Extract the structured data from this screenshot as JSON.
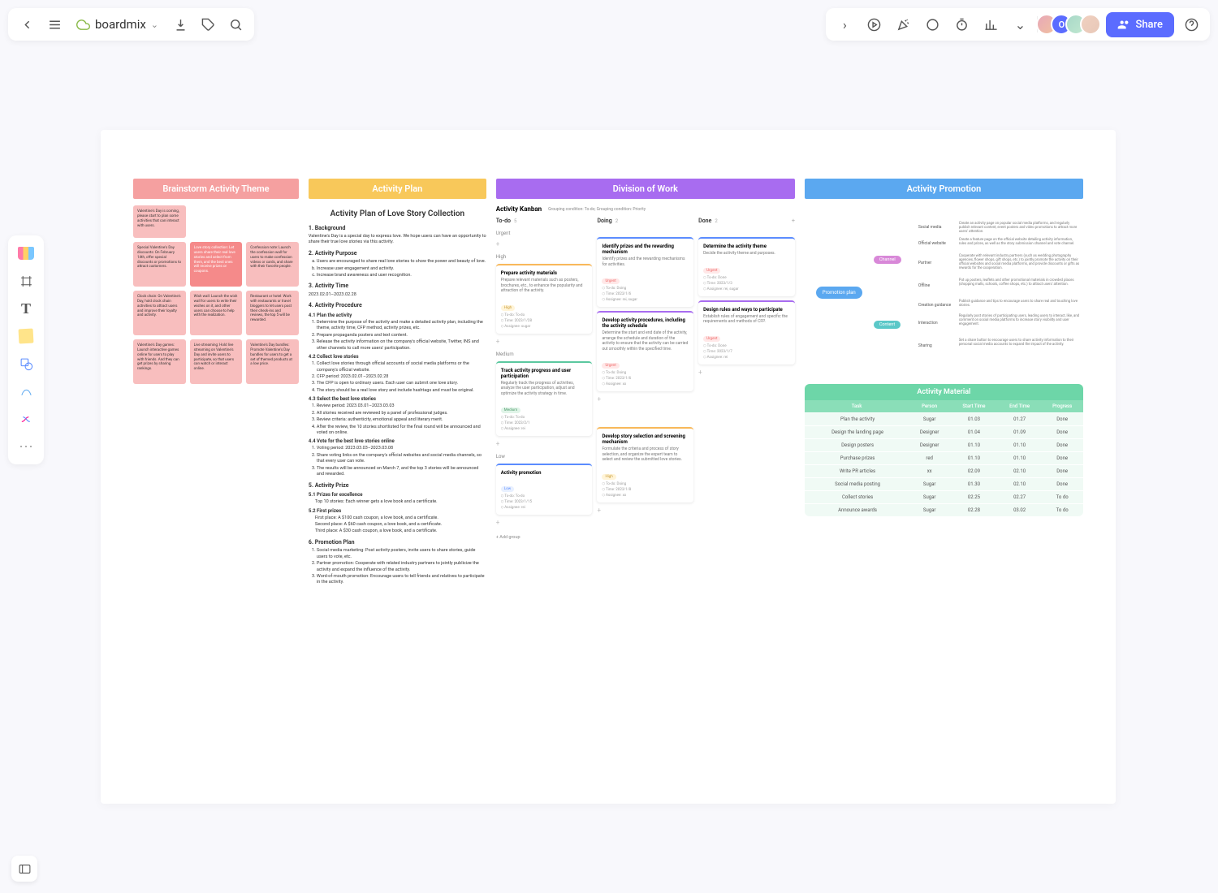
{
  "app": {
    "title": "boardmix"
  },
  "share": "Share",
  "headers": {
    "c1": "Brainstorm Activity Theme",
    "c2": "Activity Plan",
    "c3": "Division of Work",
    "c4": "Activity Promotion"
  },
  "notes": [
    "Valentine's Day is coming, please start to plan some activities that can interact with users.",
    "Special Valentine's Day discounts: On February 14th, offer special discounts or promotions to attract customers.",
    "Love story collection: Let users share their real love stories and select from them, and the best ones will receive prizes or coupons.",
    "Confession note: Launch the confession wall for users to make confession videos or cards, and share with their favorite people.",
    "Clock chain: On Valentine's Day, hold clock chain activities to attract users and improve their loyalty and activity.",
    "Wish wall: Launch the wish wall for users to write their wishes on it, and other users can choose to help with the realization.",
    "Restaurant or hotel: Work with restaurants or travel bloggers to let users post their check-ins and reviews, the top 5 will be rewarded.",
    "Valentine's Day games: Launch interactive games online for users to play with friends. And they can get prizes by sharing rankings.",
    "Live streaming: Hold live streaming on Valentine's Day and invite users to participate, so that users can watch or interact online.",
    "Valentine's Day bundles: Promote Valentine's Day bundles for users to get a set of themed products at a low price."
  ],
  "doc": {
    "title": "Activity Plan of Love Story Collection",
    "s1": "1. Background",
    "s1t": "Valentine's Day is a special day to express love. We hope users can have an opportunity to share their true love stories via this activity.",
    "s2": "2. Activity Purpose",
    "s2a": "Users are encouraged to share real love stories to show the power and beauty of love.",
    "s2b": "Increase user engagement and activity.",
    "s2c": "Increase brand awareness and user recognition.",
    "s3": "3. Activity Time",
    "s3t": "2023.02.01–2023.02.28",
    "s4": "4. Activity Procedure",
    "s41": "4.1 Plan the activity",
    "s41a": "Determine the purpose of the activity and make a detailed activity plan, including the theme, activity time, CFP method, activity prizes, etc.",
    "s41b": "Prepare propaganda posters and text content.",
    "s41c": "Release the activity information on the company's official website, Twitter, INS and other channels to call more users' participation.",
    "s42": "4.2 Collect love stories",
    "s42a": "Collect love stories through official accounts of social media platforms or the company's official website.",
    "s42b": "CFP period: 2023.02.01–2023.02.28",
    "s42c": "The CFP is open to ordinary users. Each user can submit one love story.",
    "s42d": "The story should be a real love story and include hashtags and must be original.",
    "s43": "4.3 Select the best love stories",
    "s43a": "Review period: 2023.03.01–2023.03.03",
    "s43b": "All stories received are reviewed by a panel of professional judges.",
    "s43c": "Review criteria: authenticity, emotional appeal and literary merit.",
    "s43d": "After the review, the 10 stories shortlisted for the final round will be announced and voted on online.",
    "s44": "4.4 Vote for the best love stories online",
    "s44a": "Voting period: 2023.03.03–2023.03.08",
    "s44b": "Share voting links on the company's official websites and social media channels, so that every user can vote.",
    "s44c": "The results will be announced on March 7, and the top 3 stories will be announced and rewarded.",
    "s5": "5. Activity Prize",
    "s51": "5.1 Prizes for excellence",
    "s51t": "Top 10 stories: Each winner gets a love book and a certificate.",
    "s52": "5.2 First prizes",
    "s52a": "First place: A $100 cash coupon, a love book, and a certificate.",
    "s52b": "Second place: A $60 cash coupon, a love book, and a certificate.",
    "s52c": "Third place: A $30 cash coupon, a love book, and a certificate.",
    "s6": "6. Promotion Plan",
    "s6a": "Social media marketing: Post activity posters, invite users to share stories, guide users to vote, etc.",
    "s6b": "Partner promotion: Cooperate with related industry partners to jointly publicize the activity and expand the influence of the activity.",
    "s6c": "Word-of-mouth promotion: Encourage users to tell friends and relatives to participate in the activity."
  },
  "kanban": {
    "title": "Activity Kanban",
    "sub": "Grouping condition: To-do; Grouping condition: Priority",
    "cols": {
      "todo": "To-do",
      "doing": "Doing",
      "done": "Done"
    },
    "cnt": {
      "todo": "5",
      "doing": "2",
      "done": "2"
    },
    "pri": {
      "u": "Urgent",
      "h": "High",
      "m": "Medium",
      "l": "Low"
    },
    "cards": {
      "d1": {
        "t": "Identify prizes and the rewarding mechanism",
        "d": "Identify prizes and the rewarding mechanisms for activities.",
        "tag": "Urgent",
        "m1": "To-do: Doing",
        "m2": "Time: 2023/1/6",
        "m3": "Assignee: rei, sugar"
      },
      "d2": {
        "t": "Develop activity procedures, including the activity schedule",
        "d": "Determine the start and end date of the activity, arrange the schedule and duration of the activity to ensure that the activity can be carried out smoothly within the specified time.",
        "tag": "Urgent",
        "m1": "To-do: Doing",
        "m2": "Time: 2023/1/6",
        "m3": "Assignee: xx"
      },
      "n1": {
        "t": "Determine the activity theme",
        "d": "Decide the activity theme and purposes.",
        "tag": "Urgent",
        "m1": "To-do: Done",
        "m2": "Time: 2023/1/3",
        "m3": "Assignee: rei, sugar"
      },
      "n2": {
        "t": "Design rules and ways to participate",
        "d": "Establish rules of engagement and specific the requirements and methods of CFP.",
        "tag": "Urgent",
        "m1": "To-do: Done",
        "m2": "Time: 2023/1/7",
        "m3": "Assignee: rei"
      },
      "h1": {
        "t": "Prepare activity materials",
        "d": "Prepare relevant materials such as posters, brochures, etc., to enhance the popularity and attraction of the activity.",
        "tag": "High",
        "m1": "To-do: To-do",
        "m2": "Time: 2023/1/28",
        "m3": "Assignee: sugar"
      },
      "h2": {
        "t": "Develop story selection and screening mechanism",
        "d": "Formulate the criteria and process of story selection, and organize the expert team to select and review the submitted love stories.",
        "tag": "High",
        "m1": "To-do: Doing",
        "m2": "Time: 2023/1/8",
        "m3": "Assignee: xx"
      },
      "m1": {
        "t": "Track activity progress and user participation",
        "d": "Regularly track the progress of activities, analyze the user participation, adjust and optimize the activity strategy in time.",
        "tag": "Medium",
        "m1": "To-do: To-do",
        "m2": "Time: 2023/2/1",
        "m3": "Assignee: rei"
      },
      "l1": {
        "t": "Activity promotion",
        "tag": "Low",
        "m1": "To-do: To-do",
        "m2": "Time: 2023/1/15",
        "m3": "Assignee: rei"
      }
    },
    "addg": "+ Add group"
  },
  "mindmap": {
    "root": "Promotion plan",
    "l1a": "Channel",
    "l1b": "Content",
    "l2": [
      "Social media",
      "Official website",
      "Partner",
      "Offline",
      "Creation guidance",
      "Interaction",
      "Sharing"
    ],
    "d": [
      "Create an activity page on popular social media platforms, and regularly publish relevant content, event posters and video promotions to attract more users' attention.",
      "Create a feature page on the official website detailing activity information, rules and prizes, as well as the story submission channel and vote channel.",
      "Cooperate with relevant industry partners (such as wedding photography agencies, flower shops, gift shops, etc.) to jointly promote the activity on their official websites and social media platforms, and provide discounts or gifts as rewards for the cooperation.",
      "Put up posters, leaflets and other promotional materials in crowded places (shopping malls, schools, coffee shops, etc.) to attract users' attention.",
      "Publish guidance and tips to encourage users to share real and touching love stories.",
      "Regularly post stories of participating users, leading users to interact, like, and comment on social media platforms to increase story visibility and user engagement.",
      "Set a share button to encourage users to share activity information to their personal social media accounts to expand the impact of the activity."
    ]
  },
  "table": {
    "title": "Activity Material",
    "cols": [
      "Task",
      "Person",
      "Start Time",
      "End Time",
      "Progress"
    ],
    "rows": [
      [
        "Plan the activity",
        "Sugar",
        "01.03",
        "01.27",
        "Done"
      ],
      [
        "Design the landing page",
        "Designer",
        "01.04",
        "01.09",
        "Done"
      ],
      [
        "Design posters",
        "Designer",
        "01.10",
        "01.10",
        "Done"
      ],
      [
        "Purchase prizes",
        "red",
        "01.10",
        "01.10",
        "Done"
      ],
      [
        "Write PR articles",
        "xx",
        "02.09",
        "02.10",
        "Done"
      ],
      [
        "Social media posting",
        "Sugar",
        "01.30",
        "02.10",
        "Done"
      ],
      [
        "Collect stories",
        "Sugar",
        "02.25",
        "02.27",
        "To do"
      ],
      [
        "Announce awards",
        "Sugar",
        "02.28",
        "03.02",
        "To do"
      ]
    ]
  }
}
